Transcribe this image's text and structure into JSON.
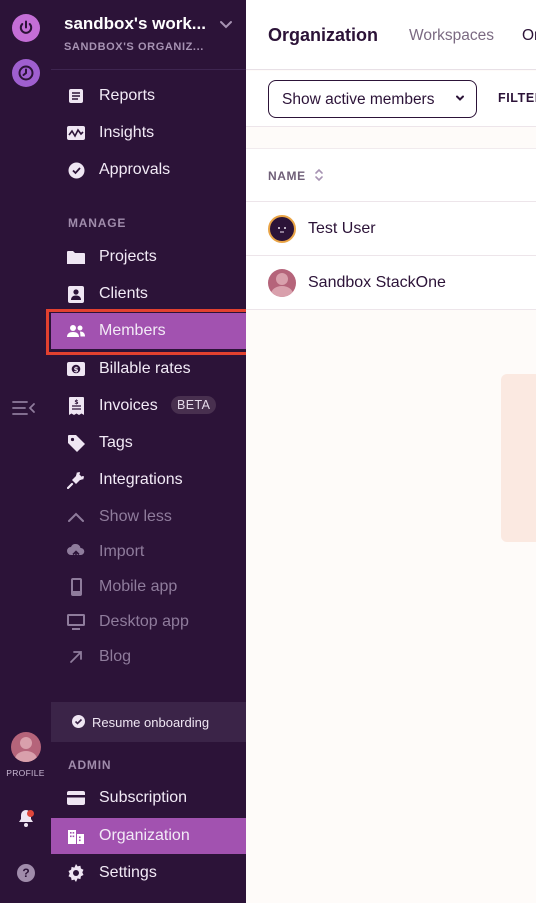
{
  "colors": {
    "sidebar_bg": "#2c1338",
    "active_item": "#a252b0",
    "highlight_border": "#e2412f",
    "main_bg": "#fefbf9"
  },
  "rail": {
    "profile_label": "PROFILE",
    "icons": [
      "power-icon",
      "clock-icon",
      "collapse-icon",
      "profile-avatar",
      "bell-icon",
      "help-icon"
    ],
    "help_glyph": "?"
  },
  "workspace": {
    "name": "sandbox's work...",
    "org": "SANDBOX'S ORGANIZ..."
  },
  "nav": {
    "top": [
      {
        "label": "Reports",
        "icon": "reports-icon"
      },
      {
        "label": "Insights",
        "icon": "insights-icon"
      },
      {
        "label": "Approvals",
        "icon": "approvals-icon"
      }
    ],
    "manage_heading": "MANAGE",
    "manage": [
      {
        "label": "Projects",
        "icon": "folder-icon"
      },
      {
        "label": "Clients",
        "icon": "client-icon"
      },
      {
        "label": "Members",
        "icon": "members-icon"
      },
      {
        "label": "Billable rates",
        "icon": "dollar-icon"
      },
      {
        "label": "Invoices",
        "icon": "invoice-icon",
        "badge": "BETA"
      },
      {
        "label": "Tags",
        "icon": "tag-icon"
      },
      {
        "label": "Integrations",
        "icon": "plug-icon"
      },
      {
        "label": "Show less",
        "icon": "chevron-up-icon"
      },
      {
        "label": "Import",
        "icon": "cloud-upload-icon"
      },
      {
        "label": "Mobile app",
        "icon": "mobile-icon"
      },
      {
        "label": "Desktop app",
        "icon": "desktop-icon"
      },
      {
        "label": "Blog",
        "icon": "external-arrow-icon"
      }
    ],
    "resume_label": "Resume onboarding",
    "admin_heading": "ADMIN",
    "admin": [
      {
        "label": "Subscription",
        "icon": "card-icon"
      },
      {
        "label": "Organization",
        "icon": "building-icon"
      },
      {
        "label": "Settings",
        "icon": "gear-icon"
      }
    ]
  },
  "main": {
    "title": "Organization",
    "tabs": [
      "Workspaces",
      "Or"
    ],
    "filter_select": "Show active members",
    "filter_label": "FILTER",
    "table": {
      "column": "NAME",
      "rows": [
        "Test User",
        "Sandbox StackOne"
      ]
    }
  }
}
